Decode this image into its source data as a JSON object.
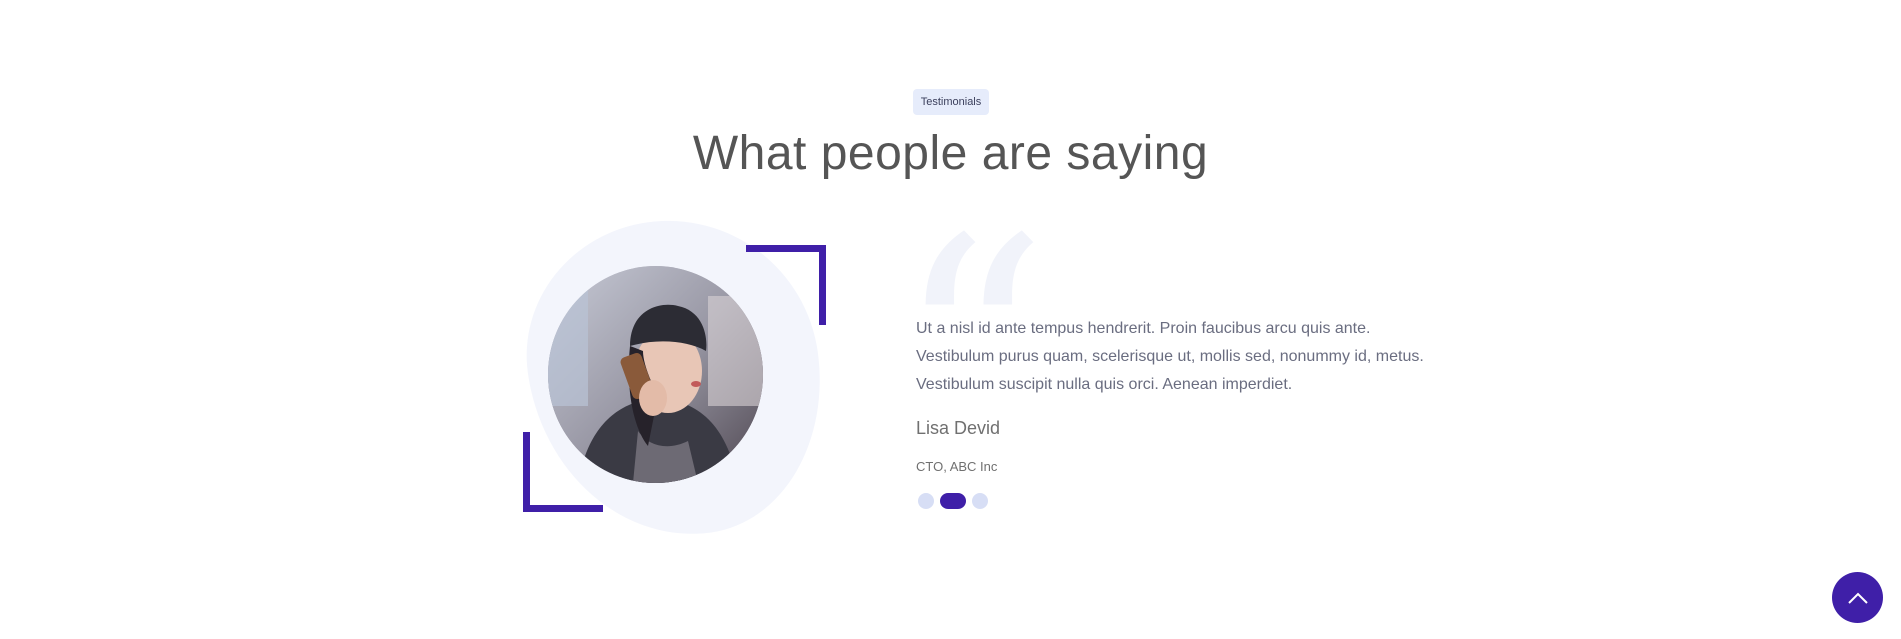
{
  "section": {
    "badge": "Testimonials",
    "title": "What people are saying"
  },
  "testimonial": {
    "quote": "Ut a nisl id ante tempus hendrerit. Proin faucibus arcu quis ante. Vestibulum purus quam, scelerisque ut, mollis sed, nonummy id, metus. Vestibulum suscipit nulla quis orci. Aenean imperdiet.",
    "quote_icon": "quote-mark-icon",
    "author_name": "Lisa Devid",
    "author_role": "CTO, ABC Inc"
  },
  "slider": {
    "total_slides": 3,
    "active_slide": 2
  },
  "scroll_top": {
    "icon": "chevron-up-icon"
  },
  "colors": {
    "accent": "#3f1fa8",
    "badge_bg": "#e6ecfb",
    "blob_bg": "#f3f5fc",
    "dot_inactive": "#d7def5"
  }
}
